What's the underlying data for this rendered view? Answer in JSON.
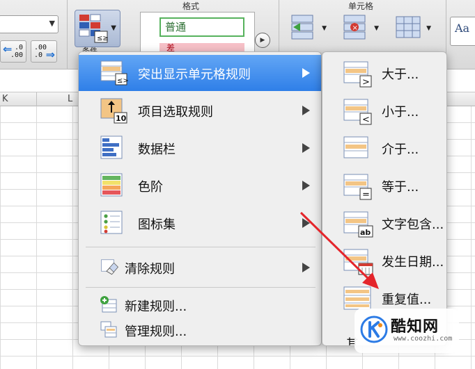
{
  "ribbon": {
    "format_group_title": "格式",
    "cells_group_title": "单元格",
    "decimal_increase": {
      "top": ".0",
      "bottom": ".00"
    },
    "decimal_decrease": {
      "top": ".00",
      "bottom": ".0"
    },
    "conditional_format_label": "条件",
    "styles": {
      "normal": "普通",
      "bad": "差"
    },
    "theme_text": "Aa"
  },
  "sheet": {
    "col_headers": [
      "K",
      "L"
    ]
  },
  "main_menu": {
    "items": [
      {
        "label": "突出显示单元格规则",
        "icon": "highlight-cells-icon",
        "submenu": true,
        "selected": true
      },
      {
        "label": "项目选取规则",
        "icon": "top-bottom-icon",
        "submenu": true,
        "badge": "10"
      },
      {
        "label": "数据栏",
        "icon": "data-bars-icon",
        "submenu": true
      },
      {
        "label": "色阶",
        "icon": "color-scales-icon",
        "submenu": true
      },
      {
        "label": "图标集",
        "icon": "icon-sets-icon",
        "submenu": true
      },
      {
        "label": "清除规则",
        "icon": "eraser-icon",
        "submenu": true
      },
      {
        "label": "新建规则...",
        "icon": "new-rule-icon",
        "submenu": false
      },
      {
        "label": "管理规则...",
        "icon": "manage-rules-icon",
        "submenu": false
      }
    ]
  },
  "sub_menu": {
    "items": [
      {
        "label": "大于...",
        "icon": "greater-than-icon",
        "symbol": ">"
      },
      {
        "label": "小于...",
        "icon": "less-than-icon",
        "symbol": "<"
      },
      {
        "label": "介于...",
        "icon": "between-icon",
        "symbol": ""
      },
      {
        "label": "等于...",
        "icon": "equal-to-icon",
        "symbol": "="
      },
      {
        "label": "文字包含...",
        "icon": "text-contains-icon",
        "symbol": "ab"
      },
      {
        "label": "发生日期...",
        "icon": "date-occurring-icon",
        "symbol": ""
      },
      {
        "label": "重复值...",
        "icon": "duplicate-values-icon",
        "symbol": ""
      }
    ],
    "bottom_partial": "其"
  },
  "watermark": {
    "name": "酷知网",
    "url": "www.coozhi.com"
  },
  "colors": {
    "selection": "#2f7fe8",
    "arrow": "#e4252b"
  }
}
